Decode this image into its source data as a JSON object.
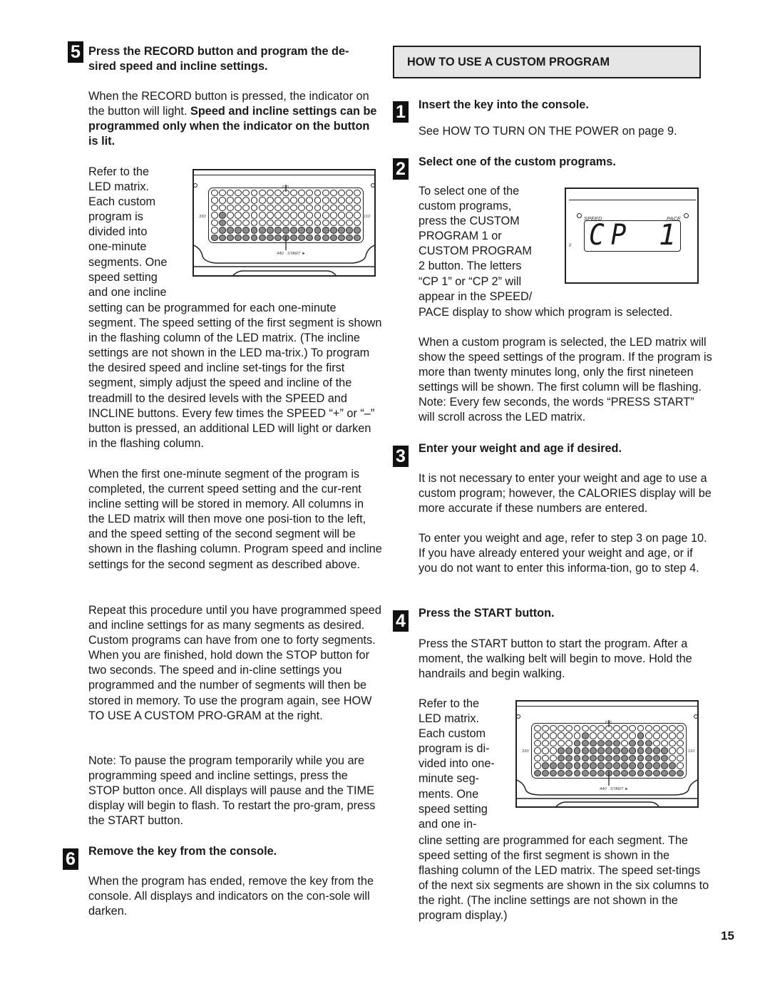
{
  "page_number": "15",
  "left_column": {
    "step5": {
      "number": "5",
      "title_line1": "Press the RECORD button and program the de-",
      "title_line2": "sired speed and incline settings.",
      "intro_normal": "When the RECORD button is pressed, the indicator on the button will light. ",
      "intro_bold": "Speed and incline settings can be programmed only when the indicator on the button is lit.",
      "wrap_lines": [
        "Refer to the",
        "LED matrix.",
        "Each custom",
        "program is",
        "divided into",
        "one-minute",
        "segments. One",
        "speed setting",
        "and one incline"
      ],
      "para1_rest": "setting can be programmed for each one-minute segment. The speed setting of the first segment is shown in the flashing column of the LED matrix. (The incline settings are not shown in the LED ma-trix.) To program the desired speed and incline set-tings for the first segment, simply adjust the speed and incline of the treadmill to the desired levels with the SPEED and INCLINE buttons. Every few times the SPEED “+” or “–” button is pressed, an additional LED will light or darken in the flashing column.",
      "para2": "When the first one-minute segment of the program is completed, the current speed setting and the cur-rent incline setting will be stored in memory. All columns in the LED matrix will then move one posi-tion to the left, and the speed setting of the second segment will be shown in the flashing column. Program speed and incline settings for the second segment as described above.",
      "para3": "Repeat this procedure until you have programmed speed and incline settings for as many segments as desired. Custom programs can have from one to forty segments. When you are finished, hold down the STOP button for two seconds. The speed and in-cline settings you programmed and the number of segments will then be stored in memory. To use the program again, see HOW TO USE A CUSTOM PRO-GRAM at the right.",
      "para4": "Note: To pause the program temporarily while you are programming speed and incline settings, press the STOP button once. All displays will pause and the TIME display will begin to flash. To restart the pro-gram, press the START button."
    },
    "step6": {
      "number": "6",
      "title": "Remove the key from the console.",
      "body": "When the program has ended, remove the key from the console. All displays and indicators on the con-sole will darken."
    },
    "led_matrix_1": {
      "label_top": "220",
      "label_left": "330",
      "label_right": "110",
      "label_bottom_left": "440",
      "label_bottom_right": "START ►",
      "rows": 7,
      "cols": 19,
      "column_fill_counts": [
        1,
        4,
        2,
        2,
        2,
        2,
        2,
        2,
        2,
        2,
        2,
        2,
        2,
        2,
        2,
        2,
        2,
        2,
        2
      ],
      "note": "column 0 fill counts: first column lights bottom 2 + extra; values are lit LEDs counted from bottom"
    }
  },
  "right_column": {
    "section_header": "HOW TO USE A CUSTOM PROGRAM",
    "step1": {
      "number": "1",
      "title": "Insert the key into the console.",
      "body": "See HOW TO TURN ON THE POWER on page 9."
    },
    "step2": {
      "number": "2",
      "title": "Select one of the custom programs.",
      "wrap_lines": [
        "To select one of the",
        "custom programs,",
        "press the CUSTOM",
        "PROGRAM 1 or",
        "CUSTOM PROGRAM",
        "2 button. The letters",
        "“CP 1” or “CP 2” will",
        "appear in the SPEED/"
      ],
      "wrap_rest": "PACE display to show which program is selected.",
      "para2": "When a custom program is selected, the LED matrix will show the speed settings of the program. If the program is more than twenty minutes long, only the first nineteen settings will be shown. The first column will be flashing. Note: Every few seconds, the words “PRESS START” will scroll across the LED matrix."
    },
    "lcd_display": {
      "left_label": "SPEED",
      "right_label": "PACE",
      "side_mark": "0",
      "readout_left": "CP",
      "readout_right": "1"
    },
    "step3": {
      "number": "3",
      "title": "Enter your weight and age if desired.",
      "para1": "It is not necessary to enter your weight and age to use a custom program; however, the CALORIES display will be more accurate if these numbers are entered.",
      "para2": "To enter you weight and age, refer to step 3 on page 10. If you have already entered your weight and age, or if you do not want to enter this informa-tion, go to step 4."
    },
    "step4": {
      "number": "4",
      "title": "Press the START button.",
      "body": "Press the START button to start the program. After a moment, the walking belt will begin to move. Hold the handrails and begin walking.",
      "wrap_lines": [
        "Refer to the",
        "LED matrix.",
        "Each custom",
        "program is di-",
        "vided into one-",
        "minute seg-",
        "ments. One",
        "speed setting",
        "and one in-"
      ],
      "wrap_rest": "cline setting are programmed for each segment. The speed setting of the first segment is shown in the flashing column of the LED matrix. The speed set-tings of the next six segments are shown in the six columns to the right. (The incline settings are not shown in the program display.)"
    },
    "led_matrix_2": {
      "label_top": "220",
      "label_left": "330",
      "label_right": "110",
      "label_bottom_left": "440",
      "label_bottom_right": "START ►",
      "rows": 7,
      "cols": 19,
      "column_fill_counts": [
        1,
        2,
        2,
        4,
        4,
        5,
        6,
        5,
        5,
        5,
        5,
        4,
        5,
        6,
        5,
        4,
        4,
        2,
        1
      ]
    }
  }
}
